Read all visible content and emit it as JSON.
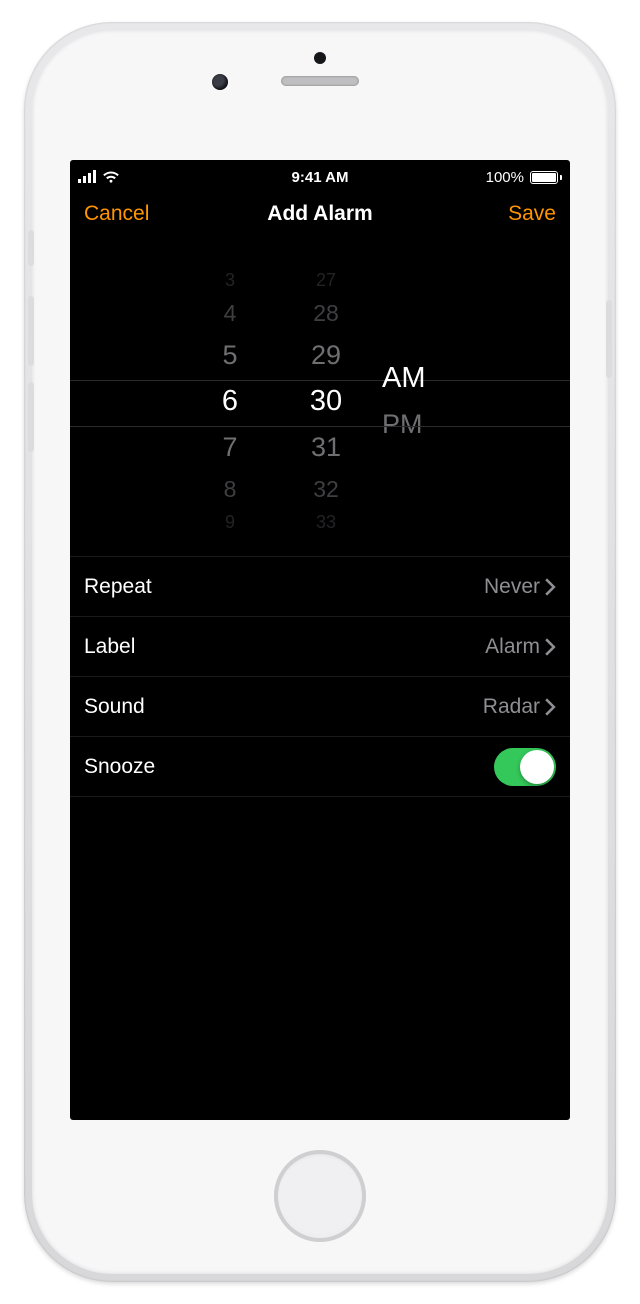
{
  "status_bar": {
    "time": "9:41 AM",
    "battery_text": "100%"
  },
  "nav": {
    "cancel_label": "Cancel",
    "title": "Add Alarm",
    "save_label": "Save"
  },
  "picker": {
    "hour": {
      "selected": "6",
      "visible": [
        "3",
        "4",
        "5",
        "6",
        "7",
        "8",
        "9"
      ]
    },
    "minute": {
      "selected": "30",
      "visible": [
        "27",
        "28",
        "29",
        "30",
        "31",
        "32",
        "33"
      ]
    },
    "period": {
      "selected": "AM",
      "other": "PM"
    }
  },
  "settings": {
    "repeat": {
      "label": "Repeat",
      "value": "Never"
    },
    "label": {
      "label": "Label",
      "value": "Alarm"
    },
    "sound": {
      "label": "Sound",
      "value": "Radar"
    },
    "snooze": {
      "label": "Snooze",
      "on": true
    }
  }
}
